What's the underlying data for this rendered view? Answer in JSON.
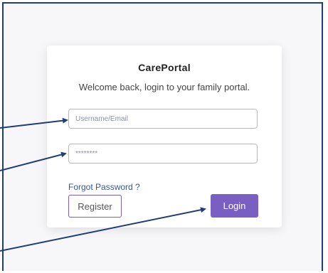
{
  "app": {
    "title": "CarePortal",
    "subtitle": "Welcome back, login to your family portal."
  },
  "form": {
    "username_placeholder": "Username/Email",
    "password_placeholder": "********",
    "forgot_label": "Forgot Password ?",
    "register_label": "Register",
    "login_label": "Login"
  },
  "colors": {
    "accent": "#7a5fc2",
    "link": "#3355a8",
    "annotation": "#1f3d7a",
    "background": "#f7f7f9"
  }
}
